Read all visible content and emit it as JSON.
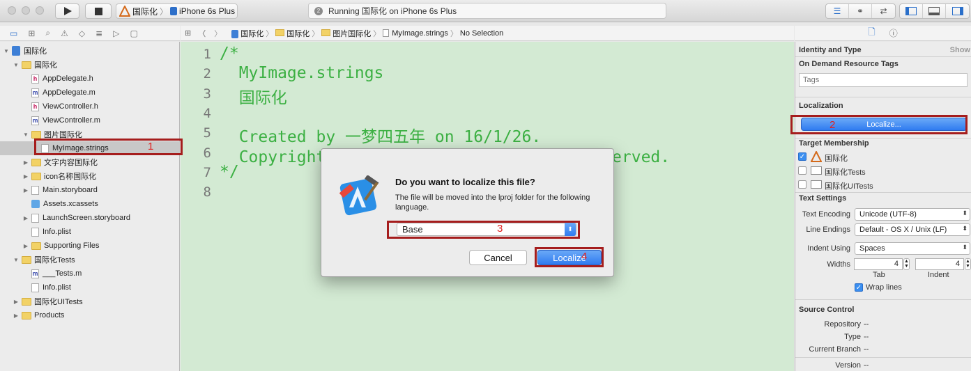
{
  "toolbar": {
    "scheme_target": "国际化",
    "scheme_device": "iPhone 6s Plus",
    "status_badge": "2",
    "status_text": "Running 国际化 on iPhone 6s Plus"
  },
  "navigator": {
    "items": [
      {
        "label": "国际化",
        "kind": "project",
        "indent": 0,
        "disclosure": "▼"
      },
      {
        "label": "国际化",
        "kind": "folder",
        "indent": 1,
        "disclosure": "▼"
      },
      {
        "label": "AppDelegate.h",
        "kind": "h",
        "indent": 2,
        "disclosure": ""
      },
      {
        "label": "AppDelegate.m",
        "kind": "m",
        "indent": 2,
        "disclosure": ""
      },
      {
        "label": "ViewController.h",
        "kind": "h",
        "indent": 2,
        "disclosure": ""
      },
      {
        "label": "ViewController.m",
        "kind": "m",
        "indent": 2,
        "disclosure": ""
      },
      {
        "label": "图片国际化",
        "kind": "folder",
        "indent": 2,
        "disclosure": "▼"
      },
      {
        "label": "MyImage.strings",
        "kind": "plain",
        "indent": 3,
        "disclosure": "",
        "selected": true
      },
      {
        "label": "文字内容国际化",
        "kind": "folder",
        "indent": 2,
        "disclosure": "▶"
      },
      {
        "label": "icon名称国际化",
        "kind": "folder",
        "indent": 2,
        "disclosure": "▶"
      },
      {
        "label": "Main.storyboard",
        "kind": "plain",
        "indent": 2,
        "disclosure": "▶"
      },
      {
        "label": "Assets.xcassets",
        "kind": "assets",
        "indent": 2,
        "disclosure": ""
      },
      {
        "label": "LaunchScreen.storyboard",
        "kind": "plain",
        "indent": 2,
        "disclosure": "▶"
      },
      {
        "label": "Info.plist",
        "kind": "plain",
        "indent": 2,
        "disclosure": ""
      },
      {
        "label": "Supporting Files",
        "kind": "folder",
        "indent": 2,
        "disclosure": "▶"
      },
      {
        "label": "国际化Tests",
        "kind": "folder",
        "indent": 1,
        "disclosure": "▼"
      },
      {
        "label": "___Tests.m",
        "kind": "m",
        "indent": 2,
        "disclosure": ""
      },
      {
        "label": "Info.plist",
        "kind": "plain",
        "indent": 2,
        "disclosure": ""
      },
      {
        "label": "国际化UITests",
        "kind": "folder",
        "indent": 1,
        "disclosure": "▶"
      },
      {
        "label": "Products",
        "kind": "folder",
        "indent": 1,
        "disclosure": "▶"
      }
    ]
  },
  "jumpbar": {
    "crumbs": [
      "国际化",
      "国际化",
      "图片国际化",
      "MyImage.strings",
      "No Selection"
    ]
  },
  "editor": {
    "lines": [
      {
        "num": "1",
        "text": "/*"
      },
      {
        "num": "2",
        "text": "  MyImage.strings"
      },
      {
        "num": "3",
        "text": "  国际化"
      },
      {
        "num": "4",
        "text": ""
      },
      {
        "num": "5",
        "text": "  Created by 一梦四五年 on 16/1/26."
      },
      {
        "num": "6",
        "text": "  Copyright © 2016年 GZbx. All rights reserved."
      },
      {
        "num": "7",
        "text": "*/"
      },
      {
        "num": "8",
        "text": ""
      }
    ]
  },
  "inspector": {
    "identity_title": "Identity and Type",
    "identity_show": "Show",
    "odr_title": "On Demand Resource Tags",
    "tags_placeholder": "Tags",
    "localization_title": "Localization",
    "localize_button": "Localize...",
    "membership_title": "Target Membership",
    "targets": [
      {
        "label": "国际化",
        "checked": true
      },
      {
        "label": "国际化Tests",
        "checked": false
      },
      {
        "label": "国际化UITests",
        "checked": false
      }
    ],
    "text_settings_title": "Text Settings",
    "text_encoding_label": "Text Encoding",
    "text_encoding_value": "Unicode (UTF-8)",
    "line_endings_label": "Line Endings",
    "line_endings_value": "Default - OS X / Unix (LF)",
    "indent_using_label": "Indent Using",
    "indent_using_value": "Spaces",
    "widths_label": "Widths",
    "tab_value": "4",
    "indent_value": "4",
    "tab_label": "Tab",
    "indent_label": "Indent",
    "wrap_lines_label": "Wrap lines",
    "source_control_title": "Source Control",
    "repository_label": "Repository",
    "repository_value": "--",
    "type_label": "Type",
    "type_value": "--",
    "branch_label": "Current Branch",
    "branch_value": "--",
    "version_label": "Version",
    "version_value": "--"
  },
  "dialog": {
    "title": "Do you want to localize this file?",
    "message": "The file will be moved into the lproj folder for the following language.",
    "language": "Base",
    "cancel": "Cancel",
    "localize": "Localize"
  },
  "annotations": [
    "1",
    "2",
    "3",
    "4"
  ],
  "colors": {
    "editor_bg": "#d3ead3",
    "code_text": "#3cb043",
    "annotation_red": "#a51d1d",
    "primary_blue": "#2f7bf0"
  }
}
